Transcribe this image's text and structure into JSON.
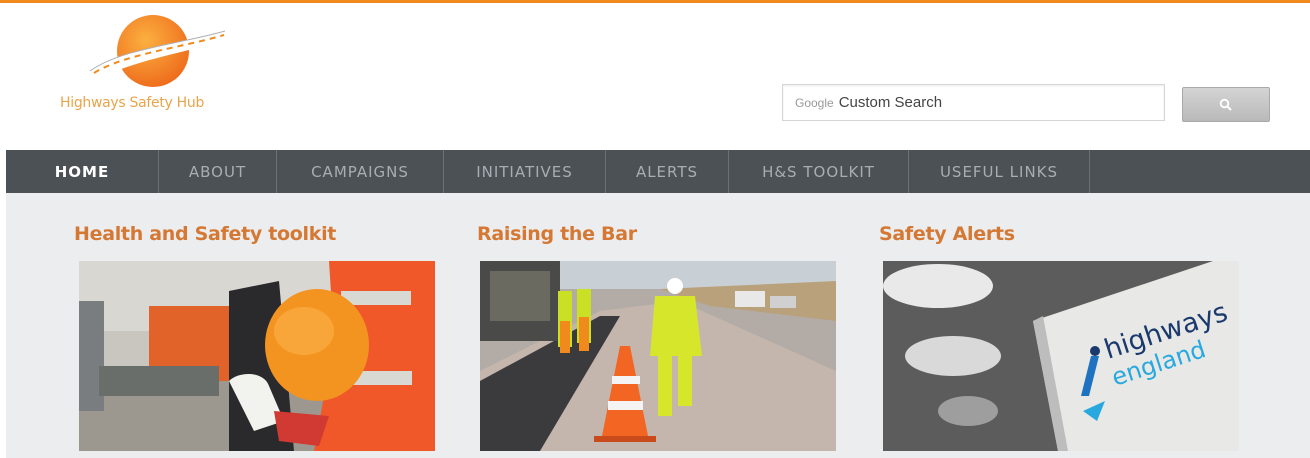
{
  "brand": {
    "name": "Highways Safety Hub",
    "accent_color": "#f08a1c"
  },
  "search": {
    "brand_label": "Google",
    "placeholder": "Custom Search",
    "button_icon": "search-icon"
  },
  "nav": {
    "items": [
      {
        "label": "HOME",
        "active": true
      },
      {
        "label": "ABOUT",
        "active": false
      },
      {
        "label": "CAMPAIGNS",
        "active": false
      },
      {
        "label": "INITIATIVES",
        "active": false
      },
      {
        "label": "ALERTS",
        "active": false
      },
      {
        "label": "H&S TOOLKIT",
        "active": false
      },
      {
        "label": "USEFUL LINKS",
        "active": false
      }
    ]
  },
  "cards": [
    {
      "title": "Health and Safety toolkit",
      "image": "worker-with-hard-hat-photo"
    },
    {
      "title": "Raising the Bar",
      "image": "road-workers-photo"
    },
    {
      "title": "Safety Alerts",
      "image": "highways-england-sign-photo",
      "image_text": [
        "highways",
        "england"
      ]
    }
  ]
}
